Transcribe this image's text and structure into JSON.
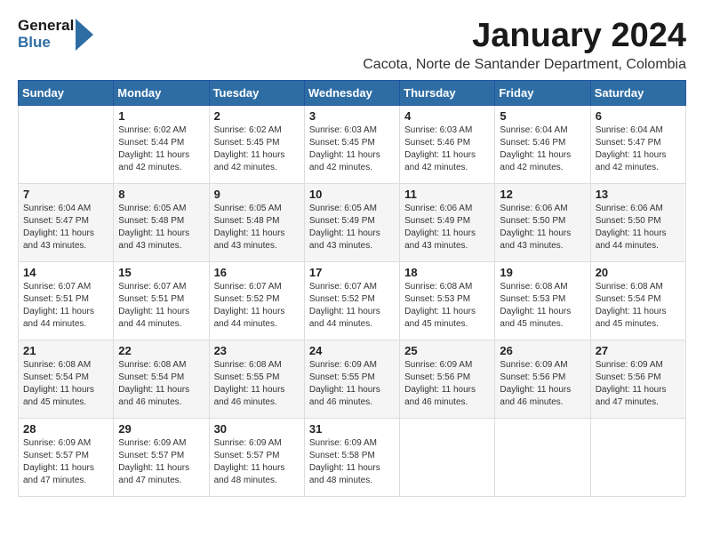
{
  "logo": {
    "line1": "General",
    "line2": "Blue"
  },
  "title": "January 2024",
  "location": "Cacota, Norte de Santander Department, Colombia",
  "weekdays": [
    "Sunday",
    "Monday",
    "Tuesday",
    "Wednesday",
    "Thursday",
    "Friday",
    "Saturday"
  ],
  "weeks": [
    [
      {
        "day": "",
        "sunrise": "",
        "sunset": "",
        "daylight": ""
      },
      {
        "day": "1",
        "sunrise": "Sunrise: 6:02 AM",
        "sunset": "Sunset: 5:44 PM",
        "daylight": "Daylight: 11 hours and 42 minutes."
      },
      {
        "day": "2",
        "sunrise": "Sunrise: 6:02 AM",
        "sunset": "Sunset: 5:45 PM",
        "daylight": "Daylight: 11 hours and 42 minutes."
      },
      {
        "day": "3",
        "sunrise": "Sunrise: 6:03 AM",
        "sunset": "Sunset: 5:45 PM",
        "daylight": "Daylight: 11 hours and 42 minutes."
      },
      {
        "day": "4",
        "sunrise": "Sunrise: 6:03 AM",
        "sunset": "Sunset: 5:46 PM",
        "daylight": "Daylight: 11 hours and 42 minutes."
      },
      {
        "day": "5",
        "sunrise": "Sunrise: 6:04 AM",
        "sunset": "Sunset: 5:46 PM",
        "daylight": "Daylight: 11 hours and 42 minutes."
      },
      {
        "day": "6",
        "sunrise": "Sunrise: 6:04 AM",
        "sunset": "Sunset: 5:47 PM",
        "daylight": "Daylight: 11 hours and 42 minutes."
      }
    ],
    [
      {
        "day": "7",
        "sunrise": "Sunrise: 6:04 AM",
        "sunset": "Sunset: 5:47 PM",
        "daylight": "Daylight: 11 hours and 43 minutes."
      },
      {
        "day": "8",
        "sunrise": "Sunrise: 6:05 AM",
        "sunset": "Sunset: 5:48 PM",
        "daylight": "Daylight: 11 hours and 43 minutes."
      },
      {
        "day": "9",
        "sunrise": "Sunrise: 6:05 AM",
        "sunset": "Sunset: 5:48 PM",
        "daylight": "Daylight: 11 hours and 43 minutes."
      },
      {
        "day": "10",
        "sunrise": "Sunrise: 6:05 AM",
        "sunset": "Sunset: 5:49 PM",
        "daylight": "Daylight: 11 hours and 43 minutes."
      },
      {
        "day": "11",
        "sunrise": "Sunrise: 6:06 AM",
        "sunset": "Sunset: 5:49 PM",
        "daylight": "Daylight: 11 hours and 43 minutes."
      },
      {
        "day": "12",
        "sunrise": "Sunrise: 6:06 AM",
        "sunset": "Sunset: 5:50 PM",
        "daylight": "Daylight: 11 hours and 43 minutes."
      },
      {
        "day": "13",
        "sunrise": "Sunrise: 6:06 AM",
        "sunset": "Sunset: 5:50 PM",
        "daylight": "Daylight: 11 hours and 44 minutes."
      }
    ],
    [
      {
        "day": "14",
        "sunrise": "Sunrise: 6:07 AM",
        "sunset": "Sunset: 5:51 PM",
        "daylight": "Daylight: 11 hours and 44 minutes."
      },
      {
        "day": "15",
        "sunrise": "Sunrise: 6:07 AM",
        "sunset": "Sunset: 5:51 PM",
        "daylight": "Daylight: 11 hours and 44 minutes."
      },
      {
        "day": "16",
        "sunrise": "Sunrise: 6:07 AM",
        "sunset": "Sunset: 5:52 PM",
        "daylight": "Daylight: 11 hours and 44 minutes."
      },
      {
        "day": "17",
        "sunrise": "Sunrise: 6:07 AM",
        "sunset": "Sunset: 5:52 PM",
        "daylight": "Daylight: 11 hours and 44 minutes."
      },
      {
        "day": "18",
        "sunrise": "Sunrise: 6:08 AM",
        "sunset": "Sunset: 5:53 PM",
        "daylight": "Daylight: 11 hours and 45 minutes."
      },
      {
        "day": "19",
        "sunrise": "Sunrise: 6:08 AM",
        "sunset": "Sunset: 5:53 PM",
        "daylight": "Daylight: 11 hours and 45 minutes."
      },
      {
        "day": "20",
        "sunrise": "Sunrise: 6:08 AM",
        "sunset": "Sunset: 5:54 PM",
        "daylight": "Daylight: 11 hours and 45 minutes."
      }
    ],
    [
      {
        "day": "21",
        "sunrise": "Sunrise: 6:08 AM",
        "sunset": "Sunset: 5:54 PM",
        "daylight": "Daylight: 11 hours and 45 minutes."
      },
      {
        "day": "22",
        "sunrise": "Sunrise: 6:08 AM",
        "sunset": "Sunset: 5:54 PM",
        "daylight": "Daylight: 11 hours and 46 minutes."
      },
      {
        "day": "23",
        "sunrise": "Sunrise: 6:08 AM",
        "sunset": "Sunset: 5:55 PM",
        "daylight": "Daylight: 11 hours and 46 minutes."
      },
      {
        "day": "24",
        "sunrise": "Sunrise: 6:09 AM",
        "sunset": "Sunset: 5:55 PM",
        "daylight": "Daylight: 11 hours and 46 minutes."
      },
      {
        "day": "25",
        "sunrise": "Sunrise: 6:09 AM",
        "sunset": "Sunset: 5:56 PM",
        "daylight": "Daylight: 11 hours and 46 minutes."
      },
      {
        "day": "26",
        "sunrise": "Sunrise: 6:09 AM",
        "sunset": "Sunset: 5:56 PM",
        "daylight": "Daylight: 11 hours and 46 minutes."
      },
      {
        "day": "27",
        "sunrise": "Sunrise: 6:09 AM",
        "sunset": "Sunset: 5:56 PM",
        "daylight": "Daylight: 11 hours and 47 minutes."
      }
    ],
    [
      {
        "day": "28",
        "sunrise": "Sunrise: 6:09 AM",
        "sunset": "Sunset: 5:57 PM",
        "daylight": "Daylight: 11 hours and 47 minutes."
      },
      {
        "day": "29",
        "sunrise": "Sunrise: 6:09 AM",
        "sunset": "Sunset: 5:57 PM",
        "daylight": "Daylight: 11 hours and 47 minutes."
      },
      {
        "day": "30",
        "sunrise": "Sunrise: 6:09 AM",
        "sunset": "Sunset: 5:57 PM",
        "daylight": "Daylight: 11 hours and 48 minutes."
      },
      {
        "day": "31",
        "sunrise": "Sunrise: 6:09 AM",
        "sunset": "Sunset: 5:58 PM",
        "daylight": "Daylight: 11 hours and 48 minutes."
      },
      {
        "day": "",
        "sunrise": "",
        "sunset": "",
        "daylight": ""
      },
      {
        "day": "",
        "sunrise": "",
        "sunset": "",
        "daylight": ""
      },
      {
        "day": "",
        "sunrise": "",
        "sunset": "",
        "daylight": ""
      }
    ]
  ]
}
